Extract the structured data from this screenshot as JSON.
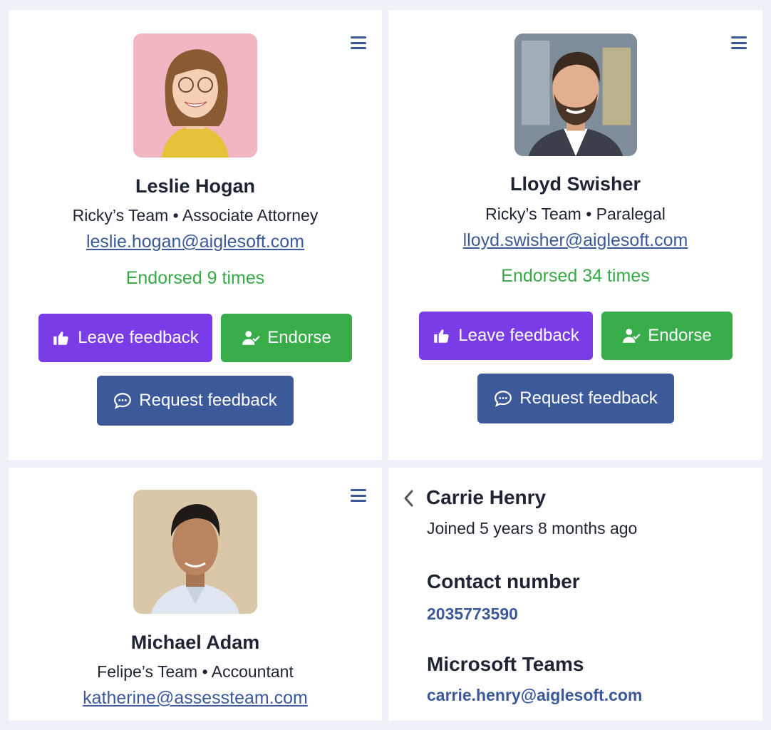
{
  "cards": [
    {
      "name": "Leslie Hogan",
      "subtitle": "Ricky’s Team • Associate Attorney",
      "email": "leslie.hogan@aiglesoft.com",
      "endorsed": "Endorsed 9 times",
      "leave_feedback": "Leave feedback",
      "endorse": "Endorse",
      "request_feedback": "Request feedback"
    },
    {
      "name": "Lloyd Swisher",
      "subtitle": "Ricky’s Team • Paralegal",
      "email": "lloyd.swisher@aiglesoft.com",
      "endorsed": "Endorsed 34 times",
      "leave_feedback": "Leave feedback",
      "endorse": "Endorse",
      "request_feedback": "Request feedback"
    },
    {
      "name": "Michael Adam",
      "subtitle": "Felipe’s Team • Accountant",
      "email": "katherine@assessteam.com"
    }
  ],
  "detail": {
    "name": "Carrie Henry",
    "joined": "Joined 5 years 8 months ago",
    "contact_label": "Contact number",
    "contact_value": "2035773590",
    "teams_label": "Microsoft Teams",
    "teams_value": "carrie.henry@aiglesoft.com"
  },
  "colors": {
    "accent_blue": "#3b5998",
    "purple": "#7a3ce6",
    "green": "#38ad4a",
    "endorsed_green": "#38a947"
  },
  "icons": [
    "menu-icon",
    "thumbs-up-icon",
    "user-check-icon",
    "chat-bubble-icon",
    "chevron-left-icon"
  ]
}
